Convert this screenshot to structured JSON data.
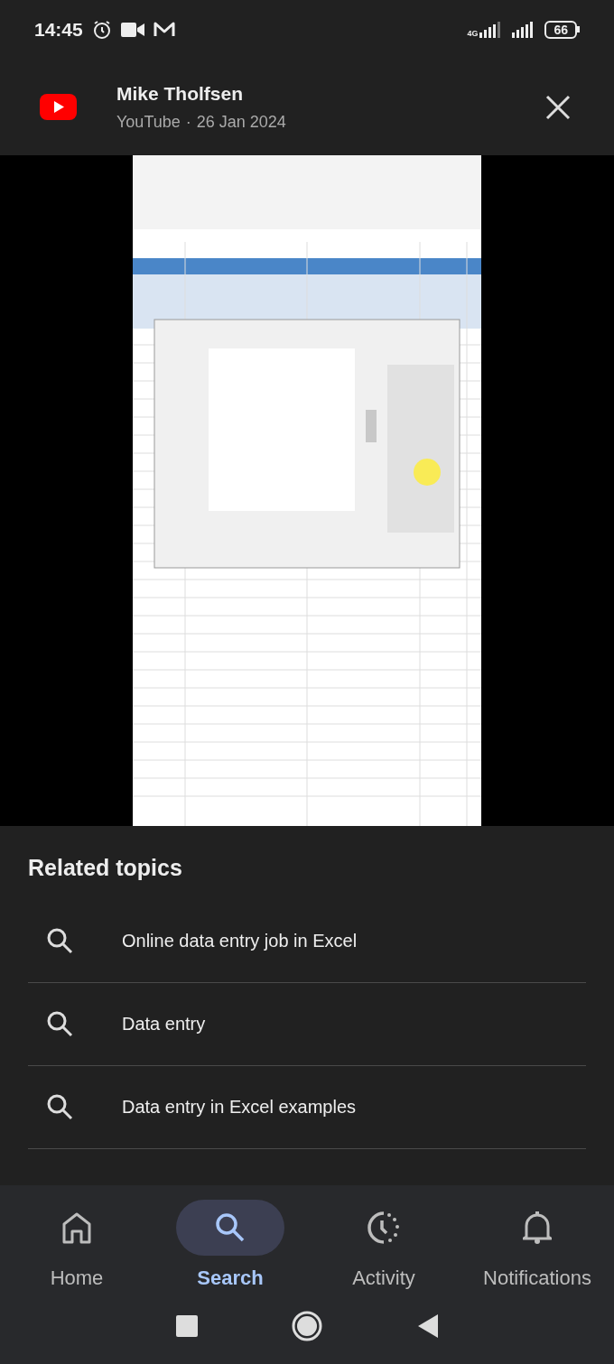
{
  "status_bar": {
    "time": "14:45",
    "network": "4G",
    "battery": "66"
  },
  "header": {
    "channel": "Mike Tholfsen",
    "source": "YouTube",
    "separator": "·",
    "date": "26 Jan 2024"
  },
  "related_topics": {
    "title": "Related topics",
    "items": [
      {
        "label": "Online data entry job in Excel"
      },
      {
        "label": "Data entry"
      },
      {
        "label": "Data entry in Excel examples"
      }
    ]
  },
  "bottom_nav": [
    {
      "label": "Home",
      "selected": false
    },
    {
      "label": "Search",
      "selected": true
    },
    {
      "label": "Activity",
      "selected": false
    },
    {
      "label": "Notifications",
      "selected": false
    }
  ]
}
